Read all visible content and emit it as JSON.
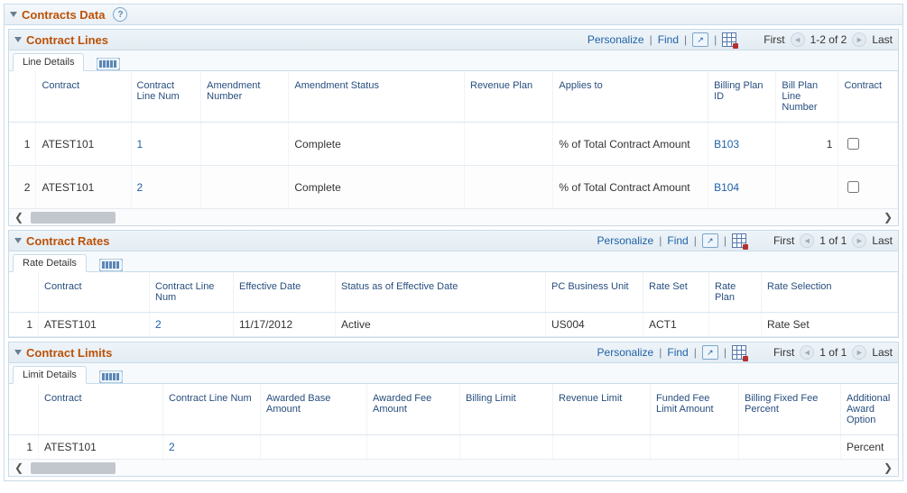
{
  "main_header": {
    "title": "Contracts Data"
  },
  "toolbar_labels": {
    "personalize": "Personalize",
    "find": "Find",
    "first": "First",
    "last": "Last"
  },
  "lines": {
    "title": "Contract Lines",
    "range": "1-2 of 2",
    "tab": "Line Details",
    "headers": {
      "rownum": "",
      "contract": "Contract",
      "line_num": "Contract Line Num",
      "amend_num": "Amendment Number",
      "amend_status": "Amendment Status",
      "rev_plan": "Revenue Plan",
      "applies_to": "Applies to",
      "bill_plan_id": "Billing Plan ID",
      "bill_plan_line": "Bill Plan Line Number",
      "contract2": "Contract"
    },
    "rows": [
      {
        "n": "1",
        "contract": "ATEST101",
        "line": "1",
        "amend": "",
        "status": "Complete",
        "rev": "",
        "applies": "% of Total Contract Amount",
        "bpid": "B103",
        "bpline": "1",
        "chk": false
      },
      {
        "n": "2",
        "contract": "ATEST101",
        "line": "2",
        "amend": "",
        "status": "Complete",
        "rev": "",
        "applies": "% of Total Contract Amount",
        "bpid": "B104",
        "bpline": "",
        "chk": false
      }
    ],
    "scroll": {
      "thumb_left": 0,
      "thumb_width": 10
    }
  },
  "rates": {
    "title": "Contract Rates",
    "range": "1 of 1",
    "tab": "Rate Details",
    "headers": {
      "rownum": "",
      "contract": "Contract",
      "line_num": "Contract Line Num",
      "eff_date": "Effective Date",
      "status": "Status as of Effective Date",
      "pc_bu": "PC Business Unit",
      "rate_set": "Rate Set",
      "rate_plan": "Rate Plan",
      "rate_sel": "Rate Selection"
    },
    "rows": [
      {
        "n": "1",
        "contract": "ATEST101",
        "line": "2",
        "eff": "11/17/2012",
        "status": "Active",
        "pc": "US004",
        "rset": "ACT1",
        "rplan": "",
        "rsel": "Rate Set"
      }
    ]
  },
  "limits": {
    "title": "Contract Limits",
    "range": "1 of 1",
    "tab": "Limit Details",
    "headers": {
      "rownum": "",
      "contract": "Contract",
      "line_num": "Contract Line Num",
      "awarded_base": "Awarded Base Amount",
      "awarded_fee": "Awarded Fee Amount",
      "billing_limit": "Billing Limit",
      "revenue_limit": "Revenue Limit",
      "funded_fee": "Funded Fee Limit Amount",
      "fixed_fee_pct": "Billing Fixed Fee Percent",
      "add_award": "Additional Award Option"
    },
    "rows": [
      {
        "n": "1",
        "contract": "ATEST101",
        "line": "2",
        "ab": "",
        "af": "",
        "bl": "",
        "rl": "",
        "ff": "",
        "ffp": "",
        "aao": "Percent"
      }
    ],
    "scroll": {
      "thumb_left": 0,
      "thumb_width": 10
    }
  }
}
